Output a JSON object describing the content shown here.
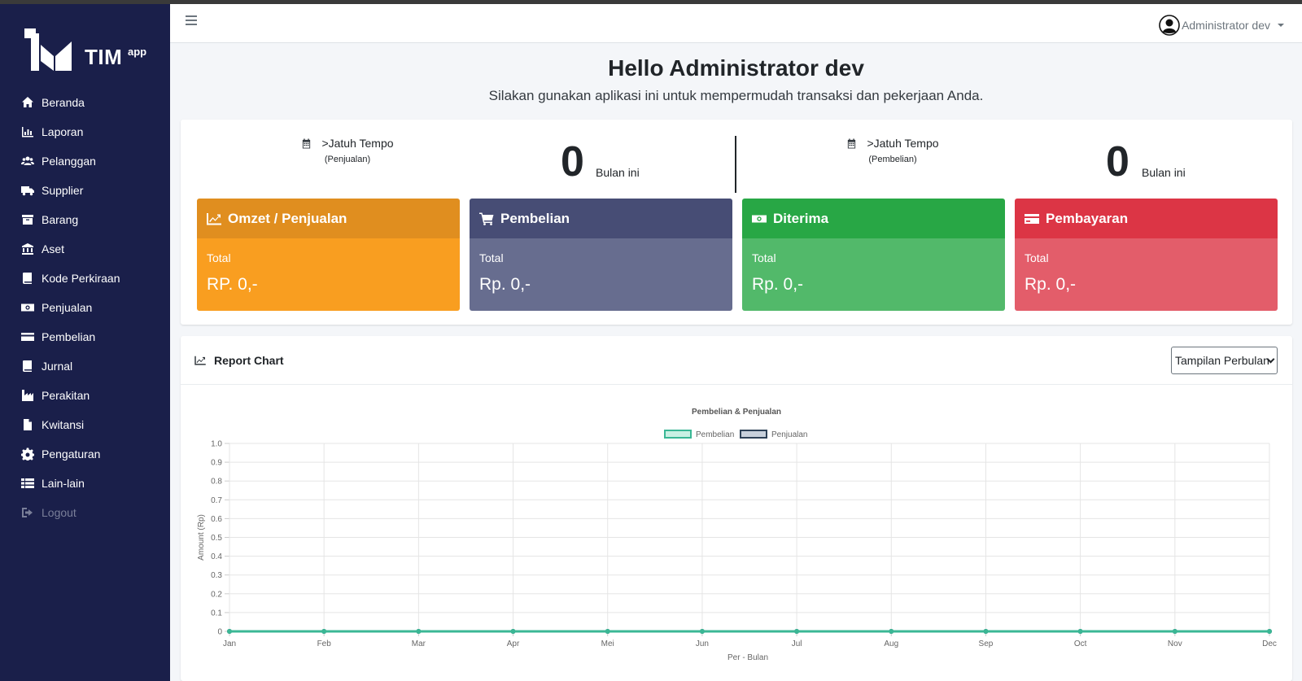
{
  "sidebar": {
    "logo_text": "TIM",
    "logo_sup": "app",
    "items": [
      {
        "label": "Beranda",
        "icon": "home-icon"
      },
      {
        "label": "Laporan",
        "icon": "bar-chart-icon"
      },
      {
        "label": "Pelanggan",
        "icon": "users-icon"
      },
      {
        "label": "Supplier",
        "icon": "truck-icon"
      },
      {
        "label": "Barang",
        "icon": "archive-icon"
      },
      {
        "label": "Aset",
        "icon": "bank-icon"
      },
      {
        "label": "Kode Perkiraan",
        "icon": "book-icon"
      },
      {
        "label": "Penjualan",
        "icon": "money-icon"
      },
      {
        "label": "Pembelian",
        "icon": "credit-card-icon"
      },
      {
        "label": "Jurnal",
        "icon": "book-icon"
      },
      {
        "label": "Perakitan",
        "icon": "industry-icon"
      },
      {
        "label": "Kwitansi",
        "icon": "file-icon"
      },
      {
        "label": "Pengaturan",
        "icon": "gear-icon"
      },
      {
        "label": "Lain-lain",
        "icon": "list-icon"
      },
      {
        "label": "Logout",
        "icon": "sign-out-icon"
      }
    ]
  },
  "topbar": {
    "user_name": "Administrator dev"
  },
  "hero": {
    "title": "Hello Administrator dev",
    "subtitle": "Silakan gunakan aplikasi ini untuk mempermudah transaksi dan pekerjaan Anda."
  },
  "due": {
    "sales": {
      "title": ">Jatuh Tempo",
      "sub": "(Penjualan)",
      "count": "0",
      "period": "Bulan ini"
    },
    "purchase": {
      "title": ">Jatuh Tempo",
      "sub": "(Pembelian)",
      "count": "0",
      "period": "Bulan ini"
    }
  },
  "cards": [
    {
      "title": "Omzet / Penjualan",
      "label": "Total",
      "value": "RP. 0,-",
      "icon": "line-chart-icon",
      "head_color": "#e08e1f",
      "body_color": "#f99e20"
    },
    {
      "title": "Pembelian",
      "label": "Total",
      "value": "Rp. 0,-",
      "icon": "cart-icon",
      "head_color": "#474d75",
      "body_color": "#676d8f"
    },
    {
      "title": "Diterima",
      "label": "Total",
      "value": "Rp. 0,-",
      "icon": "money-icon",
      "head_color": "#28a745",
      "body_color": "#52b96a"
    },
    {
      "title": "Pembayaran",
      "label": "Total",
      "value": "Rp. 0,-",
      "icon": "credit-card-icon",
      "head_color": "#dc3545",
      "body_color": "#e35d6a"
    }
  ],
  "report": {
    "title": "Report Chart",
    "period_selected": "Tampilan Perbulan"
  },
  "chart_data": {
    "type": "line",
    "title": "Pembelian & Penjualan",
    "xlabel": "Per - Bulan",
    "ylabel": "Amount (Rp)",
    "categories": [
      "Jan",
      "Feb",
      "Mar",
      "Apr",
      "Mei",
      "Jun",
      "Jul",
      "Aug",
      "Sep",
      "Oct",
      "Nov",
      "Dec"
    ],
    "y_ticks": [
      "0",
      "0.1",
      "0.2",
      "0.3",
      "0.4",
      "0.5",
      "0.6",
      "0.7",
      "0.8",
      "0.9",
      "1.0"
    ],
    "ylim": [
      0,
      1
    ],
    "grid": true,
    "legend_position": "top",
    "series": [
      {
        "name": "Pembelian",
        "values": [
          0,
          0,
          0,
          0,
          0,
          0,
          0,
          0,
          0,
          0,
          0,
          0
        ],
        "color": "#3ab795",
        "fill": "#c9f0e3"
      },
      {
        "name": "Penjualan",
        "values": [
          0,
          0,
          0,
          0,
          0,
          0,
          0,
          0,
          0,
          0,
          0,
          0
        ],
        "color": "#2e4157",
        "fill": "#c8d0db"
      }
    ]
  }
}
